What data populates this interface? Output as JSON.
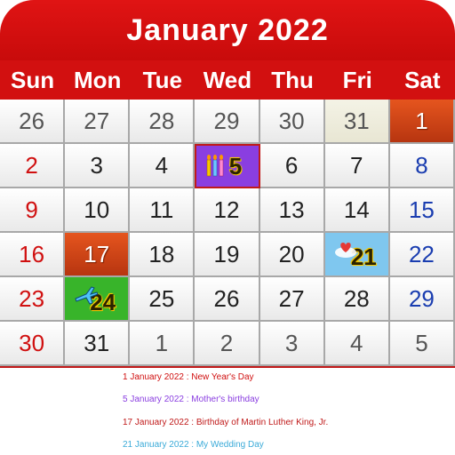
{
  "header": {
    "title": "January 2022"
  },
  "weekdays": [
    "Sun",
    "Mon",
    "Tue",
    "Wed",
    "Thu",
    "Fri",
    "Sat"
  ],
  "days": [
    [
      "26",
      "27",
      "28",
      "29",
      "30",
      "31",
      "1"
    ],
    [
      "2",
      "3",
      "4",
      "5",
      "6",
      "7",
      "8"
    ],
    [
      "9",
      "10",
      "11",
      "12",
      "13",
      "14",
      "15"
    ],
    [
      "16",
      "17",
      "18",
      "19",
      "20",
      "21",
      "22"
    ],
    [
      "23",
      "24",
      "25",
      "26",
      "27",
      "28",
      "29"
    ],
    [
      "30",
      "31",
      "1",
      "2",
      "3",
      "4",
      "5"
    ]
  ],
  "events": [
    {
      "text": "1 January 2022 : New Year's Day",
      "color": "#d01010"
    },
    {
      "text": "5 January 2022 : Mother's birthday",
      "color": "#8a3ee0"
    },
    {
      "text": "17 January 2022 : Birthday of Martin Luther King, Jr.",
      "color": "#c01a1a"
    },
    {
      "text": "21 January 2022 : My Wedding Day",
      "color": "#3aaad8"
    }
  ],
  "colors": {
    "header": "#d21010",
    "holiday": "#d0481a",
    "today": "#f1f0df",
    "birthday": "#8a3ee0",
    "wedding": "#7fc7ef",
    "travel": "#38b42a"
  },
  "icons": {
    "day5": "candles-icon",
    "day21": "heart-icon",
    "day24": "airplane-icon"
  }
}
